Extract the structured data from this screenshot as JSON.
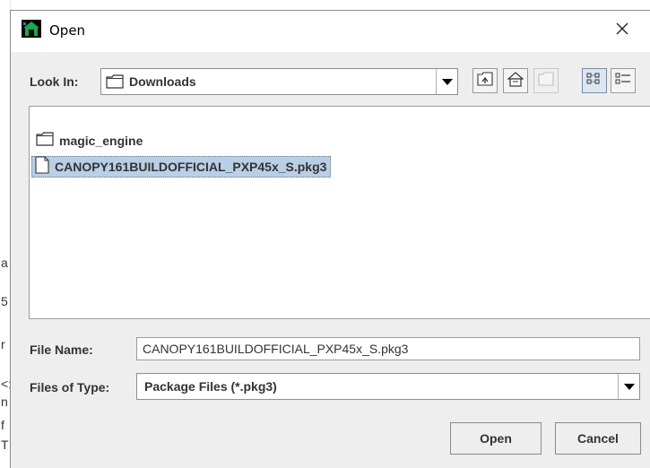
{
  "background": {
    "glyphs": [
      "a",
      "5",
      "r",
      "<:",
      "n",
      "f",
      "T"
    ]
  },
  "dialog": {
    "title": "Open",
    "icons": {
      "app": "java-app-icon",
      "close": "close-icon"
    }
  },
  "look_in": {
    "label": "Look In:",
    "value": "Downloads",
    "folder_icon": "folder-icon"
  },
  "toolbar": {
    "buttons": [
      {
        "name": "up-one-level-icon",
        "state": "enabled"
      },
      {
        "name": "home-icon",
        "state": "enabled"
      },
      {
        "name": "new-folder-icon",
        "state": "disabled"
      },
      {
        "name": "list-view-icon",
        "state": "selected"
      },
      {
        "name": "details-view-icon",
        "state": "enabled"
      }
    ]
  },
  "files": [
    {
      "name": "magic_engine",
      "type": "folder",
      "selected": false
    },
    {
      "name": "CANOPY161BUILDOFFICIAL_PXP45x_S.pkg3",
      "type": "file",
      "selected": true
    }
  ],
  "file_name": {
    "label": "File Name:",
    "value": "CANOPY161BUILDOFFICIAL_PXP45x_S.pkg3"
  },
  "file_type": {
    "label": "Files of Type:",
    "value": "Package Files (*.pkg3)"
  },
  "buttons": {
    "open": "Open",
    "cancel": "Cancel"
  },
  "colors": {
    "dialog_bg": "#eeeeee",
    "selection_bg": "#b8cfe5",
    "text": "#333333"
  }
}
